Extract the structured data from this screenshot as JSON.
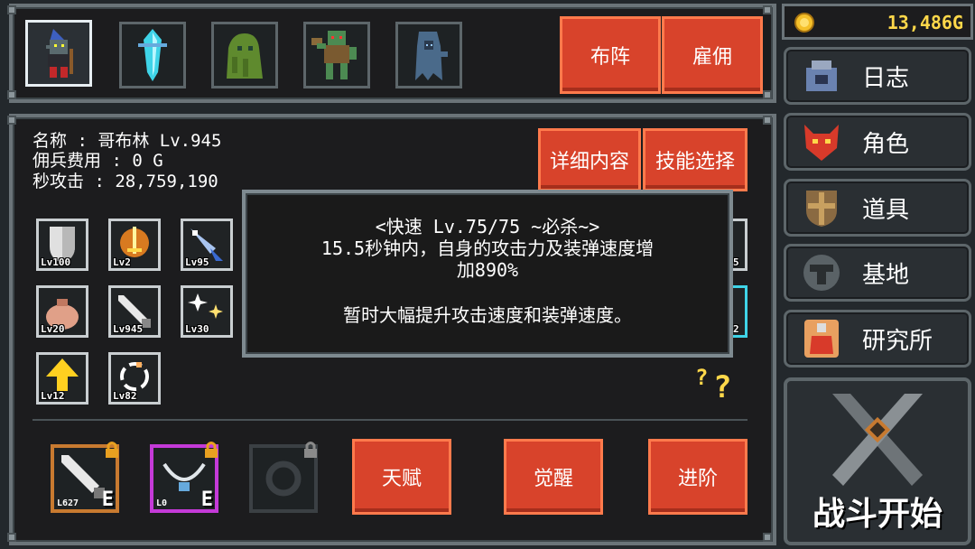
{
  "gold": "13,486G",
  "top_buttons": {
    "formation": "布阵",
    "hire": "雇佣"
  },
  "info": {
    "name": "名称 : 哥布林 Lv.945",
    "fee": "佣兵费用 : 0 G",
    "dps": "秒攻击 : 28,759,190"
  },
  "detail_buttons": {
    "details": "详细内容",
    "skills": "技能选择"
  },
  "skill_levels": [
    "Lv100",
    "Lv2",
    "Lv95",
    "Lv20",
    "Lv945",
    "Lv30",
    "Lv12",
    "Lv82"
  ],
  "partial_right": [
    "5",
    "2"
  ],
  "tooltip": {
    "title": "<快速 Lv.75/75 ~必杀~>",
    "line1": "15.5秒钟内，自身的攻击力及装弹速度增",
    "line2": "加890%",
    "desc": "暂时大幅提升攻击速度和装弹速度。"
  },
  "equipment": [
    {
      "level": "L627",
      "grade": "E"
    },
    {
      "level": "L0",
      "grade": "E"
    }
  ],
  "bottom_buttons": {
    "talent": "天赋",
    "awaken": "觉醒",
    "advance": "进阶"
  },
  "side_menu": [
    "日志",
    "角色",
    "道具",
    "基地",
    "研究所"
  ],
  "battle_start": "战斗开始",
  "colors": {
    "accent_red": "#d8432b",
    "gold": "#ffd84a",
    "orange_frame": "#c87a30",
    "purple_frame": "#c43ad8"
  }
}
